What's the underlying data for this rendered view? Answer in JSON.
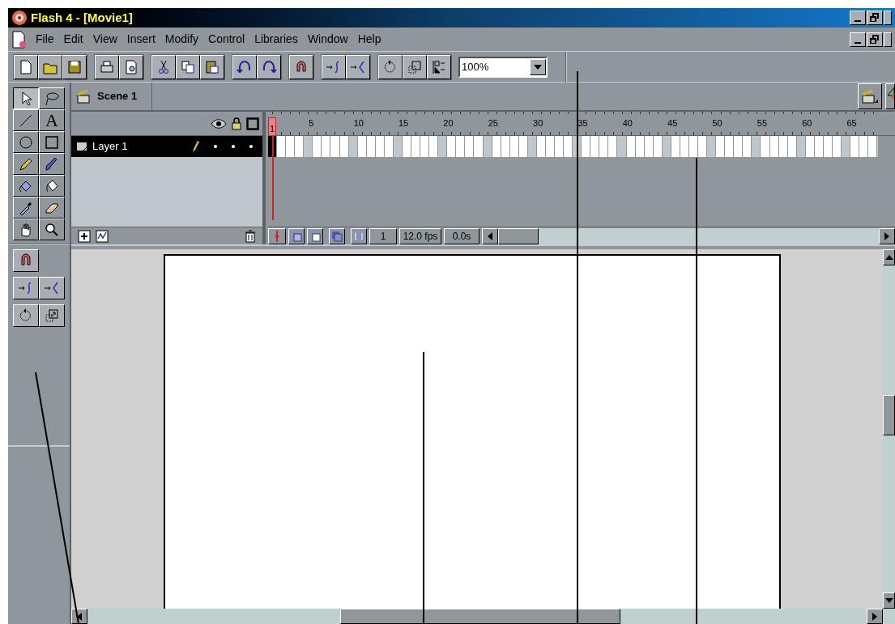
{
  "window": {
    "title": "Flash 4 - [Movie1]"
  },
  "menu": [
    "File",
    "Edit",
    "View",
    "Insert",
    "Modify",
    "Control",
    "Libraries",
    "Window",
    "Help"
  ],
  "toolbar": {
    "zoom": "100%"
  },
  "tools": [
    {
      "kind": "arrow",
      "selected": true
    },
    {
      "kind": "lasso",
      "selected": false
    },
    {
      "kind": "line",
      "selected": false
    },
    {
      "kind": "text",
      "label": "A",
      "selected": false
    },
    {
      "kind": "oval",
      "selected": false
    },
    {
      "kind": "rect",
      "selected": false
    },
    {
      "kind": "pencil",
      "selected": false
    },
    {
      "kind": "brush",
      "selected": false
    },
    {
      "kind": "ink",
      "selected": false
    },
    {
      "kind": "bucket",
      "selected": false
    },
    {
      "kind": "dropper",
      "selected": false
    },
    {
      "kind": "eraser",
      "selected": false
    },
    {
      "kind": "hand",
      "selected": false
    },
    {
      "kind": "zoom",
      "selected": false
    }
  ],
  "scene": {
    "name": "Scene 1"
  },
  "timeline": {
    "ruler": [
      "1",
      "5",
      "10",
      "15",
      "20",
      "25",
      "30",
      "35",
      "40",
      "45",
      "50",
      "55",
      "60",
      "65"
    ],
    "layers": [
      {
        "name": "Layer 1",
        "selected": true
      }
    ],
    "current_frame": "1",
    "fps": "12.0 fps",
    "time": "0.0s"
  }
}
